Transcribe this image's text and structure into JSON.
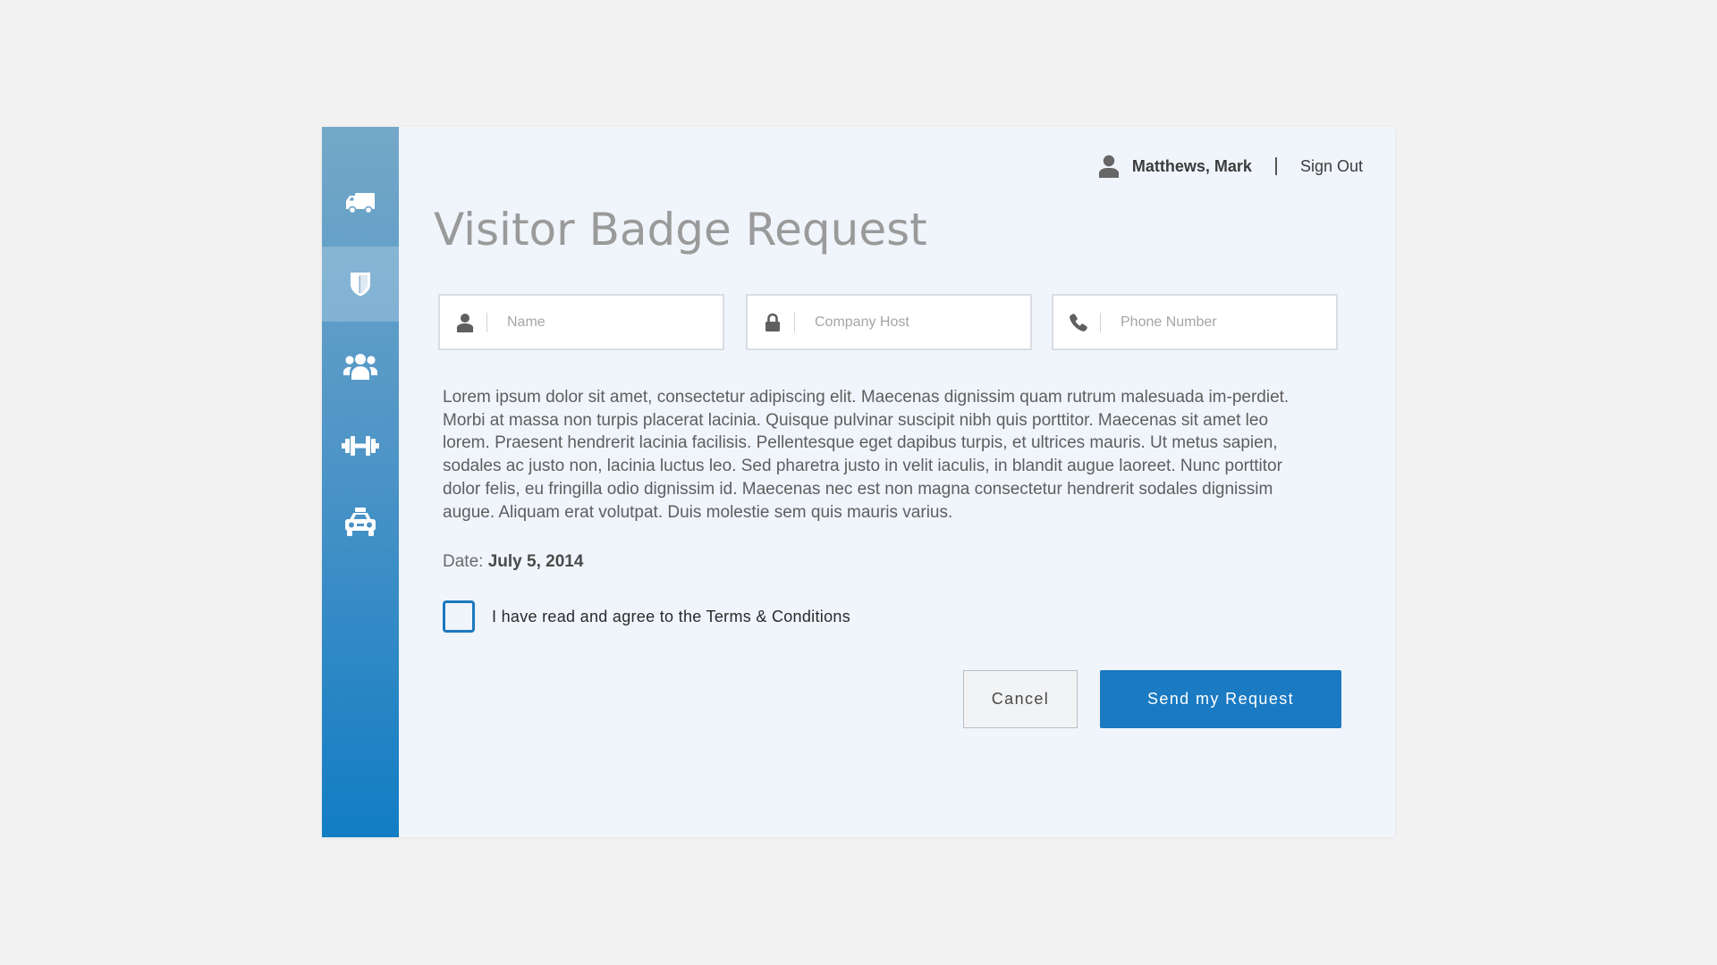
{
  "user": {
    "name": "Matthews, Mark",
    "signout_label": "Sign Out"
  },
  "page": {
    "title": "Visitor Badge Request"
  },
  "fields": {
    "name": {
      "placeholder": "Name",
      "value": ""
    },
    "company_host": {
      "placeholder": "Company Host",
      "value": ""
    },
    "phone": {
      "placeholder": "Phone Number",
      "value": ""
    }
  },
  "body_text": "Lorem ipsum dolor sit amet, consectetur adipiscing elit. Maecenas dignissim quam rutrum malesuada im-perdiet. Morbi at massa non turpis placerat lacinia. Quisque pulvinar suscipit nibh quis porttitor. Maecenas sit amet leo lorem. Praesent hendrerit lacinia facilisis. Pellentesque eget dapibus turpis, et ultrices mauris. Ut metus sapien, sodales ac justo non, lacinia luctus leo. Sed pharetra justo in velit iaculis, in blandit augue laoreet. Nunc porttitor dolor felis, eu fringilla odio dignissim id. Maecenas nec est non magna consectetur hendrerit sodales dignissim augue. Aliquam erat volutpat. Duis molestie sem quis mauris varius.",
  "date": {
    "label": "Date:",
    "value": "July 5, 2014"
  },
  "terms": {
    "label": "I have read and agree to the Terms & Conditions",
    "checked": false
  },
  "buttons": {
    "cancel": "Cancel",
    "send": "Send my Request"
  },
  "sidebar": {
    "items": [
      {
        "icon": "truck-icon",
        "active": false
      },
      {
        "icon": "shield-icon",
        "active": true
      },
      {
        "icon": "group-icon",
        "active": false
      },
      {
        "icon": "dumbbell-icon",
        "active": false
      },
      {
        "icon": "car-icon",
        "active": false
      }
    ]
  },
  "colors": {
    "accent": "#1a7ac2",
    "sidebar_top": "#74a8c8",
    "sidebar_bottom": "#127dc4",
    "card_bg": "#f0f4fb",
    "page_bg": "#f2f2f2"
  }
}
